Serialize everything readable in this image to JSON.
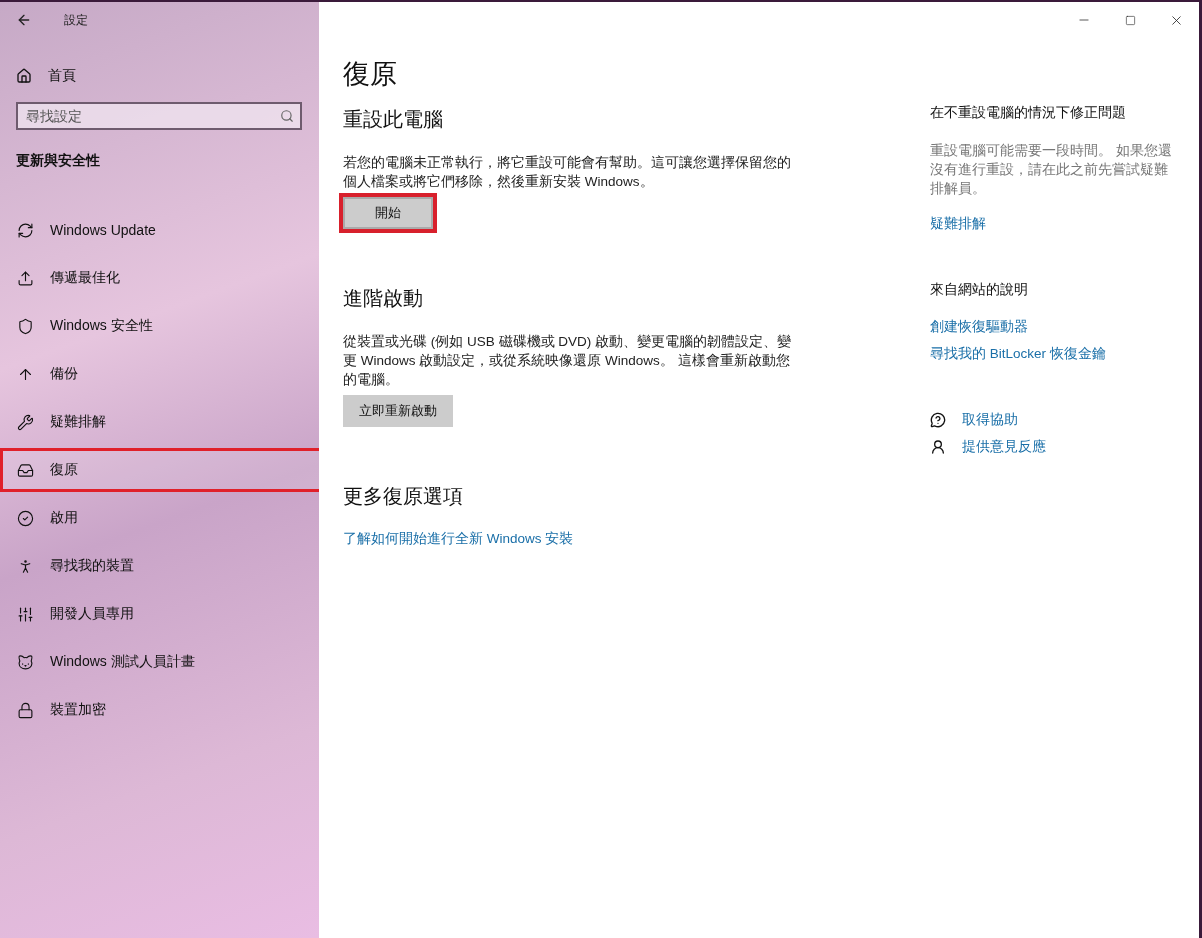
{
  "window": {
    "title": "設定"
  },
  "sidebar": {
    "home": "首頁",
    "search": {
      "placeholder": "尋找設定"
    },
    "section": "更新與安全性",
    "items": [
      {
        "label": "Windows Update",
        "selected": false
      },
      {
        "label": "傳遞最佳化",
        "selected": false
      },
      {
        "label": "Windows 安全性",
        "selected": false
      },
      {
        "label": "備份",
        "selected": false
      },
      {
        "label": "疑難排解",
        "selected": false
      },
      {
        "label": "復原",
        "selected": true
      },
      {
        "label": "啟用",
        "selected": false
      },
      {
        "label": "尋找我的裝置",
        "selected": false
      },
      {
        "label": "開發人員專用",
        "selected": false
      },
      {
        "label": "Windows 測試人員計畫",
        "selected": false
      },
      {
        "label": "裝置加密",
        "selected": false
      }
    ]
  },
  "main": {
    "title": "復原",
    "sections": [
      {
        "heading": "重設此電腦",
        "text": "若您的電腦未正常執行，將它重設可能會有幫助。這可讓您選擇保留您的個人檔案或將它們移除，然後重新安裝 Windows。",
        "button": {
          "label": "開始",
          "highlighted": true
        }
      },
      {
        "heading": "進階啟動",
        "text": "從裝置或光碟 (例如 USB 磁碟機或 DVD) 啟動、變更電腦的韌體設定、變更 Windows 啟動設定，或從系統映像還原 Windows。 這樣會重新啟動您的電腦。",
        "button": {
          "label": "立即重新啟動",
          "highlighted": false
        }
      },
      {
        "heading": "更多復原選項",
        "link": "了解如何開始進行全新 Windows 安裝"
      }
    ]
  },
  "aside": {
    "fix": {
      "heading": "在不重設電腦的情況下修正問題",
      "text": "重設電腦可能需要一段時間。 如果您還沒有進行重設，請在此之前先嘗試疑難排解員。",
      "link": "疑難排解"
    },
    "web_help": {
      "heading": "來自網站的說明",
      "links": [
        "創建恢復驅動器",
        "尋找我的 BitLocker 恢復金鑰"
      ]
    },
    "actions": [
      {
        "kind": "help",
        "label": "取得協助"
      },
      {
        "kind": "feedback",
        "label": "提供意見反應"
      }
    ]
  }
}
